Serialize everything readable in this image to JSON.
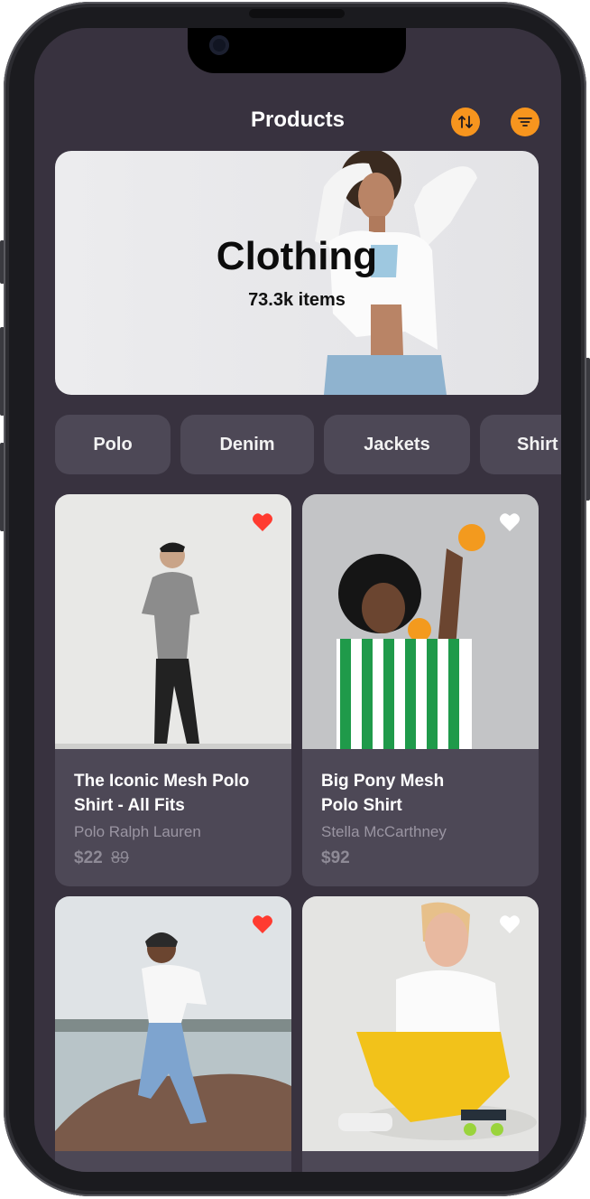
{
  "header": {
    "title": "Products",
    "sort_icon": "sort-arrows-icon",
    "filter_icon": "filter-lines-icon",
    "accent_color": "#f7951e"
  },
  "hero": {
    "title": "Clothing",
    "count": "73.3k items"
  },
  "categories": [
    {
      "label": "Polo"
    },
    {
      "label": "Denim"
    },
    {
      "label": "Jackets"
    },
    {
      "label": "Shirt"
    }
  ],
  "products": [
    {
      "name": "The Iconic Mesh Polo Shirt - All Fits",
      "brand": "Polo Ralph Lauren",
      "price": "$22",
      "old_price": "89",
      "favorite": true
    },
    {
      "name": "Big Pony Mesh Polo Shirt",
      "brand": "Stella McCarthney",
      "price": "$92",
      "old_price": "",
      "favorite": false
    },
    {
      "name": "",
      "brand": "",
      "price": "",
      "old_price": "",
      "favorite": true
    },
    {
      "name": "",
      "brand": "",
      "price": "",
      "old_price": "",
      "favorite": false
    }
  ],
  "colors": {
    "background": "#38323f",
    "card": "#4d4856",
    "favorite_active": "#ff3b30",
    "favorite_inactive": "#ffffff"
  }
}
